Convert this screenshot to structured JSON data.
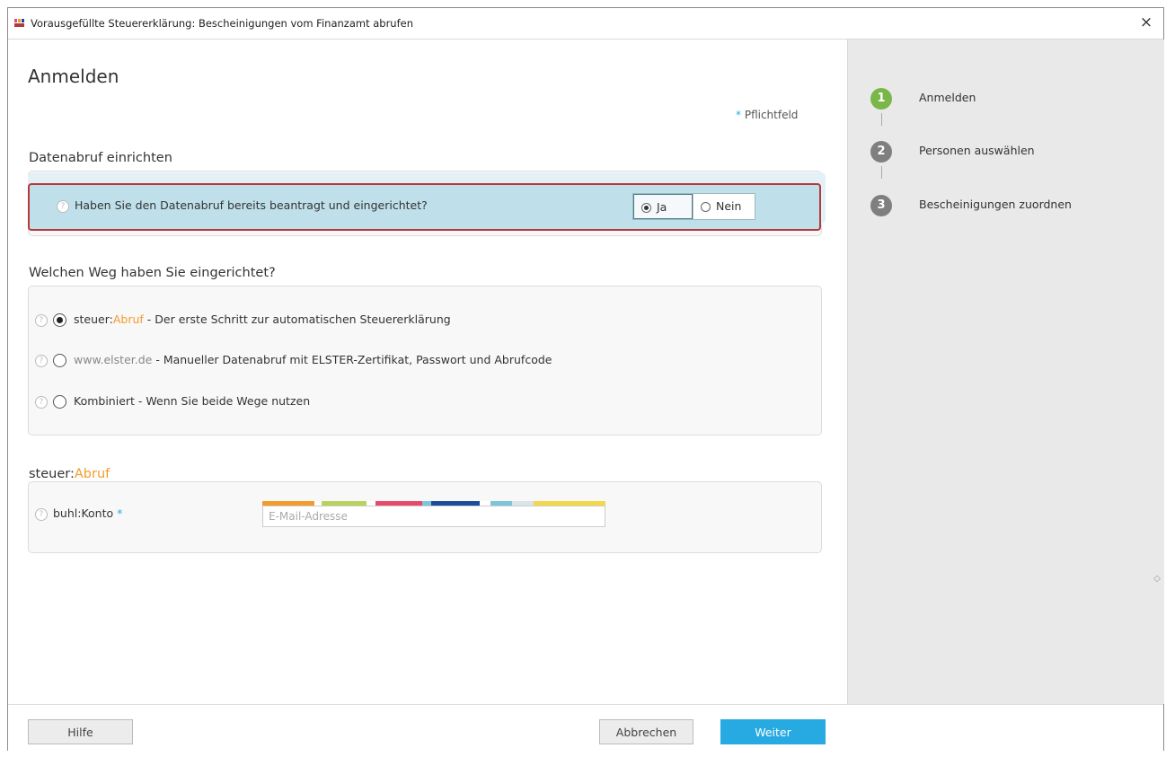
{
  "window": {
    "title": "Vorausgefüllte Steuererklärung: Bescheinigungen vom Finanzamt abrufen",
    "close_symbol": "×",
    "app_icon": "buhl-app-icon"
  },
  "main": {
    "page_title": "Anmelden",
    "required_note": {
      "star": "*",
      "text": "Pflichtfeld"
    },
    "datenabruf": {
      "heading": "Datenabruf einrichten",
      "question": "Haben Sie den Datenabruf bereits beantragt und eingerichtet?",
      "options": [
        {
          "label": "Ja",
          "selected": true
        },
        {
          "label": "Nein",
          "selected": false
        }
      ]
    },
    "weg": {
      "heading": "Welchen Weg haben Sie eingerichtet?",
      "options": [
        {
          "prefix": "steuer:",
          "accent": "Abruf",
          "description": " - Der erste Schritt zur automatischen Steuererklärung",
          "selected": true
        },
        {
          "prefix": "",
          "accent": "www.elster.de",
          "description": " - Manueller Datenabruf mit ELSTER-Zertifikat, Passwort und Abrufcode",
          "selected": false
        },
        {
          "prefix": "",
          "accent": "Kombiniert",
          "description": " - Wenn Sie beide Wege nutzen",
          "selected": false
        }
      ]
    },
    "steuerabruf": {
      "heading_prefix": "steuer:",
      "heading_accent": "Abruf",
      "konto_label": "buhl:Konto",
      "konto_required": "*",
      "email_placeholder": "E-Mail-Adresse",
      "email_value": "",
      "colorbar": [
        "#f39b2b",
        "#b7d35c",
        "#e64a6a",
        "#1c4d9a",
        "#7ec5d9",
        "#f2d84a"
      ]
    },
    "help_symbol": "?"
  },
  "steps": [
    {
      "number": "1",
      "label": "Anmelden",
      "color": "#7ab648",
      "active": true
    },
    {
      "number": "2",
      "label": "Personen auswählen",
      "color": "#7f7f7f",
      "active": false
    },
    {
      "number": "3",
      "label": "Bescheinigungen zuordnen",
      "color": "#7f7f7f",
      "active": false
    }
  ],
  "footer": {
    "help_label": "Hilfe",
    "cancel_label": "Abbrechen",
    "next_label": "Weiter"
  },
  "colors": {
    "accent_blue": "#27a9e1",
    "accent_orange": "#f39b2b",
    "highlight_border": "#b33a3a"
  }
}
